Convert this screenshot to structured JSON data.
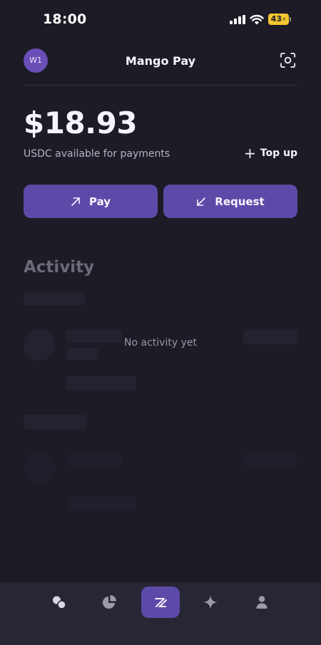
{
  "status_bar": {
    "time": "18:00",
    "battery": "43",
    "icons": [
      "cellular-signal-icon",
      "wifi-icon",
      "battery-charging-icon"
    ]
  },
  "header": {
    "avatar_initials": "W1",
    "title": "Mango Pay",
    "scan_icon": "scan-icon"
  },
  "balance": {
    "amount": "$18.93",
    "caption": "USDC available for payments",
    "topup_label": "Top up"
  },
  "actions": {
    "pay_label": "Pay",
    "request_label": "Request"
  },
  "activity": {
    "title": "Activity",
    "empty_text": "No activity yet"
  },
  "tabbar": {
    "items": [
      {
        "icon": "coins-icon",
        "active": false
      },
      {
        "icon": "pie-chart-icon",
        "active": false
      },
      {
        "icon": "mango-logo-icon",
        "active": true
      },
      {
        "icon": "sparkle-icon",
        "active": false
      },
      {
        "icon": "profile-icon",
        "active": false
      }
    ]
  },
  "colors": {
    "background": "#1c1b26",
    "accent": "#5d4aa8",
    "battery": "#f2c631",
    "tabbar": "#272634"
  }
}
